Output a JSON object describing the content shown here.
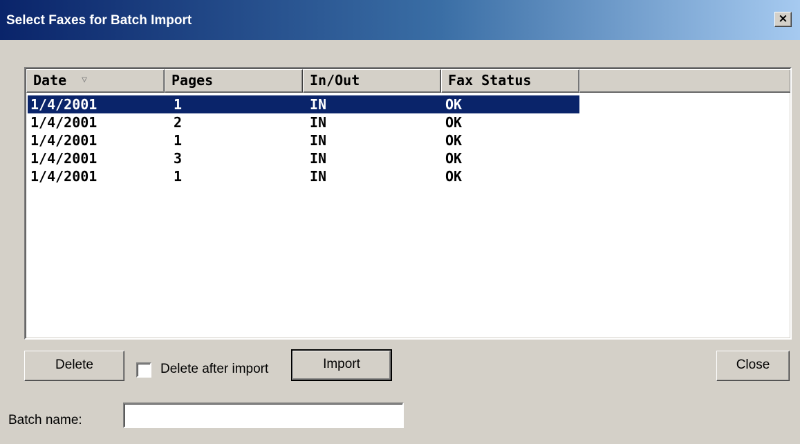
{
  "window": {
    "title": "Select Faxes for Batch Import",
    "close_glyph": "×"
  },
  "list": {
    "columns": [
      {
        "label": "Date",
        "sort": "descending"
      },
      {
        "label": "Pages"
      },
      {
        "label": "In/Out"
      },
      {
        "label": "Fax Status"
      }
    ],
    "sort_arrow": "▽",
    "rows": [
      {
        "date": "1/4/2001",
        "pages": "1",
        "inout": "IN",
        "status": "OK",
        "selected": true
      },
      {
        "date": "1/4/2001",
        "pages": "2",
        "inout": "IN",
        "status": "OK",
        "selected": false
      },
      {
        "date": "1/4/2001",
        "pages": "1",
        "inout": "IN",
        "status": "OK",
        "selected": false
      },
      {
        "date": "1/4/2001",
        "pages": "3",
        "inout": "IN",
        "status": "OK",
        "selected": false
      },
      {
        "date": "1/4/2001",
        "pages": "1",
        "inout": "IN",
        "status": "OK",
        "selected": false
      }
    ]
  },
  "buttons": {
    "delete_label": "Delete",
    "import_label": "Import",
    "close_label": "Close"
  },
  "options": {
    "delete_after_import_label": "Delete after import",
    "delete_after_import_checked": false
  },
  "batch": {
    "label": "Batch name:",
    "value": ""
  },
  "colors": {
    "title_start": "#0a246a",
    "title_end": "#a6caf0",
    "selection": "#0a246a",
    "face": "#d4d0c8"
  }
}
